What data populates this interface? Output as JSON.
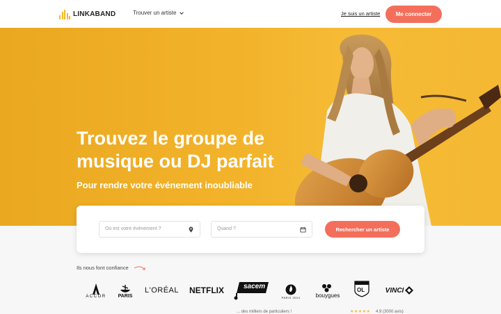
{
  "header": {
    "logo_text": "LINKABAND",
    "nav_find": "Trouver un artiste",
    "nav_artist": "Je suis un artiste",
    "login": "Me connecter"
  },
  "hero": {
    "title": "Trouvez le groupe de musique ou DJ parfait",
    "subtitle": "Pour rendre votre événement inoubliable"
  },
  "search": {
    "where_placeholder": "Où est votre évènement ?",
    "when_placeholder": "Quand ?",
    "button": "Rechercher un artiste"
  },
  "trust": {
    "label": "Ils nous font confiance",
    "brands": {
      "accor": "ACCOR",
      "paris": "PARIS",
      "loreal": "L'ORÉAL",
      "netflix": "NETFLIX",
      "sacem": "sacem",
      "paris2024": "PARIS 2024",
      "bouygues": "bouygues",
      "ol": "OL",
      "vinci": "VINCI"
    }
  },
  "footer": {
    "text": "... des milliers de particuliers !",
    "rating": "4.9 (3000 avis)"
  },
  "colors": {
    "accent": "#f36f5b",
    "hero_yellow": "#f2b22a",
    "logo_yellow": "#f5b52a"
  }
}
